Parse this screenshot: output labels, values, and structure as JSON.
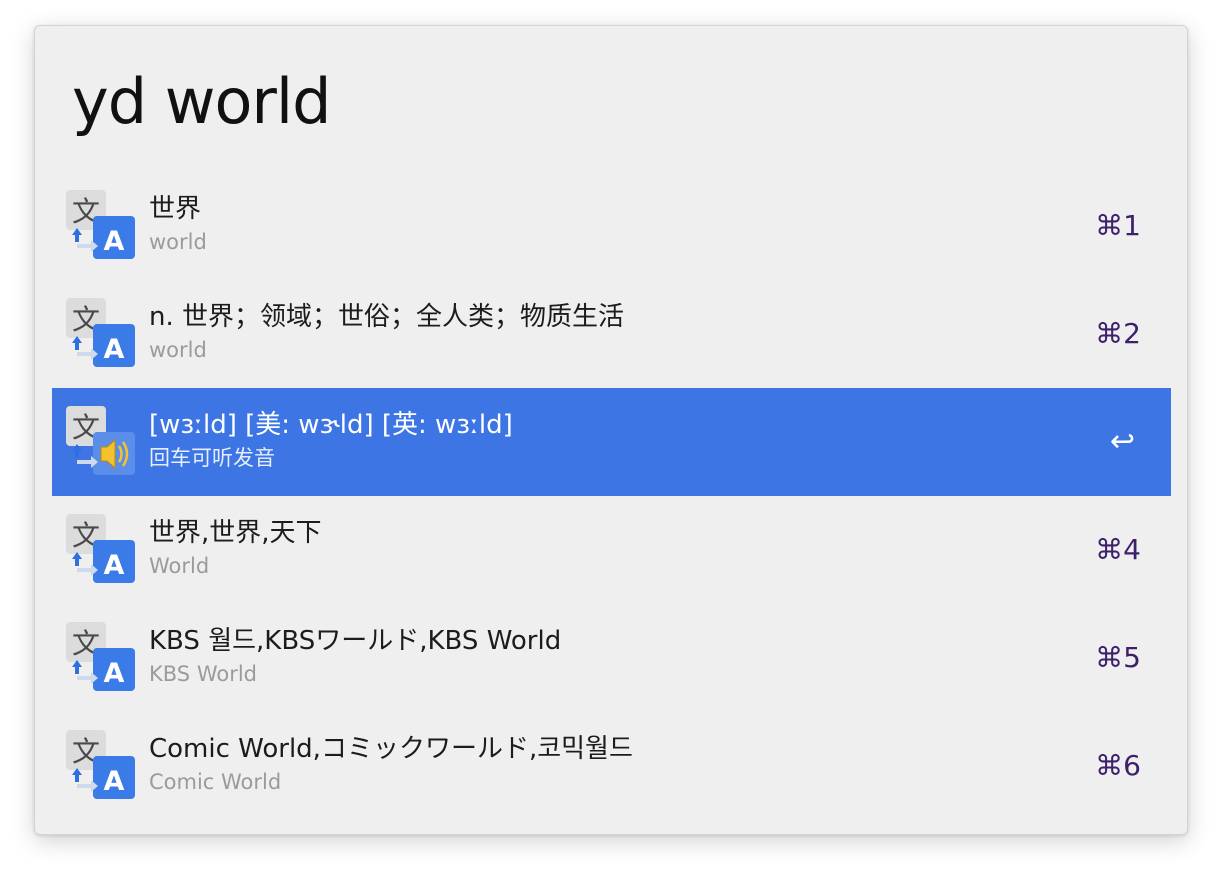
{
  "search": {
    "query": "yd world"
  },
  "colors": {
    "window_bg": "#efefef",
    "selection": "#3d75e4",
    "title_text": "#1c1c1c",
    "subtitle_text": "#9b9b9b",
    "shortcut_text": "#3d1f6a",
    "icon_blue": "#3a7be8"
  },
  "results": [
    {
      "title": "世界",
      "subtitle": "world",
      "shortcut": "⌘1",
      "icon": "translate-icon",
      "selected": false
    },
    {
      "title": "n. 世界；领域；世俗；全人类；物质生活",
      "subtitle": "world",
      "shortcut": "⌘2",
      "icon": "translate-icon",
      "selected": false
    },
    {
      "title": "[wɜːld] [美: wɝld] [英: wɜːld]",
      "subtitle": "回车可听发音",
      "shortcut": "↩",
      "icon": "translate-speaker-icon",
      "selected": true
    },
    {
      "title": "世界,世界,天下",
      "subtitle": "World",
      "shortcut": "⌘4",
      "icon": "translate-icon",
      "selected": false
    },
    {
      "title": "KBS 월드,KBSワールド,KBS World",
      "subtitle": "KBS World",
      "shortcut": "⌘5",
      "icon": "translate-icon",
      "selected": false
    },
    {
      "title": "Comic World,コミックワールド,코믹월드",
      "subtitle": "Comic World",
      "shortcut": "⌘6",
      "icon": "translate-icon",
      "selected": false
    }
  ]
}
